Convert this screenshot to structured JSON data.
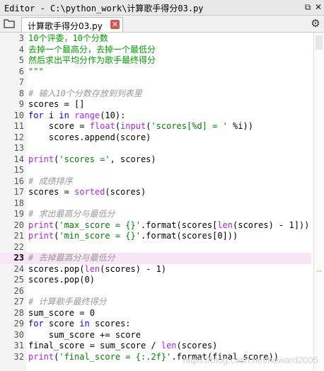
{
  "window": {
    "title": "Editor - C:\\python_work\\计算歌手得分03.py"
  },
  "tab": {
    "label": "计算歌手得分03.py"
  },
  "icons": {
    "restore": "restore-icon",
    "close": "close-icon",
    "browse": "browse-tabs-icon",
    "options": "gear-icon"
  },
  "editor": {
    "current_line": "23",
    "lines": [
      {
        "num": "3",
        "text": "10个评委，10个分数"
      },
      {
        "num": "4",
        "text": "去掉一个最高分，去掉一个最低分"
      },
      {
        "num": "5",
        "text": "然后求出平均分作为歌手最终得分"
      },
      {
        "num": "6",
        "text": "\"\"\""
      },
      {
        "num": "7",
        "text": ""
      },
      {
        "num": "8",
        "text": "# 输入10个分数存放到列表里"
      },
      {
        "num": "9",
        "text": "scores = []"
      },
      {
        "num": "10",
        "text": "for i in range(10):"
      },
      {
        "num": "11",
        "text": "    score = float(input('scores[%d] = ' %i))"
      },
      {
        "num": "12",
        "text": "    scores.append(score)"
      },
      {
        "num": "13",
        "text": ""
      },
      {
        "num": "14",
        "text": "print('scores =', scores)"
      },
      {
        "num": "15",
        "text": ""
      },
      {
        "num": "16",
        "text": "# 成绩排序"
      },
      {
        "num": "17",
        "text": "scores = sorted(scores)"
      },
      {
        "num": "18",
        "text": ""
      },
      {
        "num": "19",
        "text": "# 求出最高分与最低分"
      },
      {
        "num": "20",
        "text": "print('max_score = {}'.format(scores[len(scores) - 1]))"
      },
      {
        "num": "21",
        "text": "print('min_score = {}'.format(scores[0]))"
      },
      {
        "num": "22",
        "text": ""
      },
      {
        "num": "23",
        "text": "# 去掉最高分与最低分"
      },
      {
        "num": "24",
        "text": "scores.pop(len(scores) - 1)"
      },
      {
        "num": "25",
        "text": "scores.pop(0)"
      },
      {
        "num": "26",
        "text": ""
      },
      {
        "num": "27",
        "text": "# 计算歌手最终得分"
      },
      {
        "num": "28",
        "text": "sum_score = 0"
      },
      {
        "num": "29",
        "text": "for score in scores:"
      },
      {
        "num": "30",
        "text": "    sum_score += score"
      },
      {
        "num": "31",
        "text": "final_score = sum_score / len(scores)"
      },
      {
        "num": "32",
        "text": "print('final_score = {:.2f}'.format(final_score))"
      }
    ]
  },
  "watermark": "https://blog.csdn.net/howard2005",
  "colors": {
    "keyword": "#0000ff",
    "string": "#008000",
    "comment": "#999999",
    "builtin": "#aa22ff",
    "current_line": "#f8e6f6",
    "tab_close": "#d9534f"
  }
}
